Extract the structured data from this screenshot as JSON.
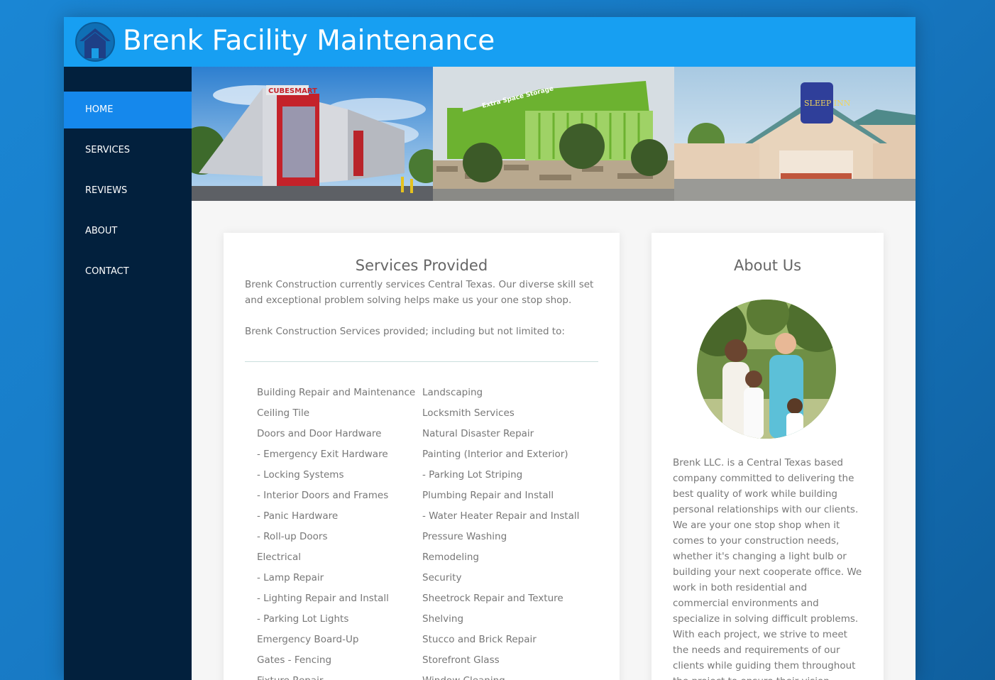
{
  "header": {
    "title": "Brenk Facility Maintenance"
  },
  "nav": [
    {
      "label": "HOME",
      "active": true
    },
    {
      "label": "SERVICES"
    },
    {
      "label": "REVIEWS"
    },
    {
      "label": "ABOUT"
    },
    {
      "label": "CONTACT"
    }
  ],
  "banner": {
    "photo1": {
      "sign": "CUBESMART"
    },
    "photo2": {
      "sign": "Extra Space Storage"
    },
    "photo3": {
      "sign": "SLEEP INN"
    }
  },
  "services": {
    "title": "Services Provided",
    "intro": "Brenk Construction currently services Central Texas. Our diverse skill set and exceptional problem solving helps make us your one stop shop.",
    "subtitle": "Brenk Construction Services provided; including but not limited to:",
    "col1": [
      "Building Repair and Maintenance",
      "Ceiling Tile",
      "Doors and Door Hardware",
      "- Emergency Exit Hardware",
      "- Locking Systems",
      "- Interior Doors and Frames",
      "- Panic Hardware",
      "- Roll-up Doors",
      "Electrical",
      "- Lamp Repair",
      "- Lighting Repair and Install",
      "- Parking Lot Lights",
      "Emergency Board-Up",
      "Gates - Fencing",
      "Fixture Repair"
    ],
    "col2": [
      "Landscaping",
      "Locksmith Services",
      "Natural Disaster Repair",
      "Painting (Interior and Exterior)",
      "- Parking Lot Striping",
      "Plumbing Repair and Install",
      "- Water Heater Repair and Install",
      "Pressure Washing",
      "Remodeling",
      "Security",
      "Sheetrock Repair and Texture",
      "Shelving",
      "Stucco and Brick Repair",
      "Storefront Glass",
      "Window Cleaning"
    ]
  },
  "about": {
    "title": "About Us",
    "text": "Brenk LLC. is a Central Texas based company committed to delivering the best quality of work while building personal relationships with our clients. We are your one stop shop when it comes to your construction needs, whether it's changing a light bulb or building your next cooperate office. We work in both residential and commercial environments and specialize in solving difficult problems. With each project, we strive to meet the needs and requirements of our clients while guiding them throughout the project to ensure their vision becomes reality."
  }
}
